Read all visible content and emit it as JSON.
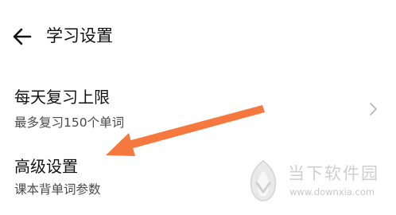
{
  "header": {
    "back_icon": "arrow-left-icon",
    "title": "学习设置"
  },
  "settings": [
    {
      "title": "每天复习上限",
      "subtitle": "最多复习150个单词",
      "icon": "chevron-right-icon"
    },
    {
      "title": "高级设置",
      "subtitle": "课本背单词参数"
    }
  ],
  "annotation": {
    "icon": "arrow-pointer-icon",
    "color": "#f5793e"
  },
  "watermark": {
    "name": "当下软件园",
    "url": "www.downxia.com",
    "logo_icon": "downxia-logo-icon"
  }
}
